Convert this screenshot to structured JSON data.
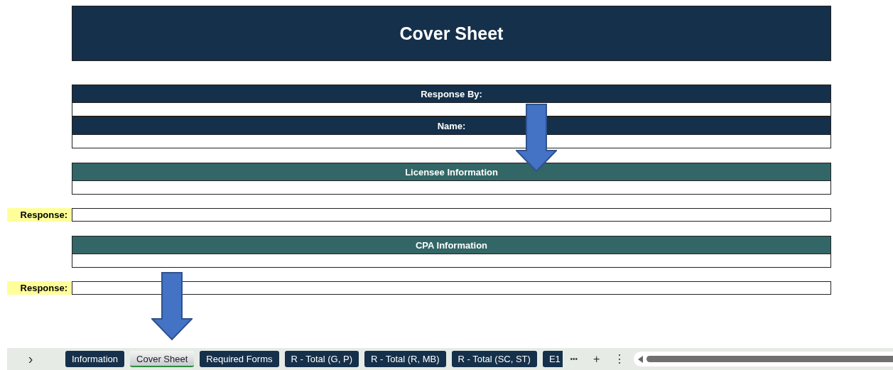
{
  "title": "Cover Sheet",
  "rows": [
    {
      "kind": "header",
      "text": "Response By:"
    },
    {
      "kind": "blank"
    },
    {
      "kind": "header",
      "text": "Name:"
    },
    {
      "kind": "blank"
    },
    {
      "kind": "section",
      "text": "Licensee Information"
    },
    {
      "kind": "blank"
    },
    {
      "kind": "response",
      "label": "Response:"
    },
    {
      "kind": "section",
      "text": "CPA Information"
    },
    {
      "kind": "blank"
    },
    {
      "kind": "response",
      "label": "Response:"
    }
  ],
  "sheet_tabs": {
    "next": "›",
    "tabs": [
      {
        "label": "Information",
        "selected": false
      },
      {
        "label": "Cover Sheet",
        "selected": true
      },
      {
        "label": "Required Forms",
        "selected": false
      },
      {
        "label": "R - Total (G, P)",
        "selected": false
      },
      {
        "label": "R - Total (R, MB)",
        "selected": false
      },
      {
        "label": "R - Total (SC, ST)",
        "selected": false
      },
      {
        "label": "E1",
        "selected": false
      }
    ],
    "more": "•••",
    "add": "+",
    "options": "⋮"
  }
}
